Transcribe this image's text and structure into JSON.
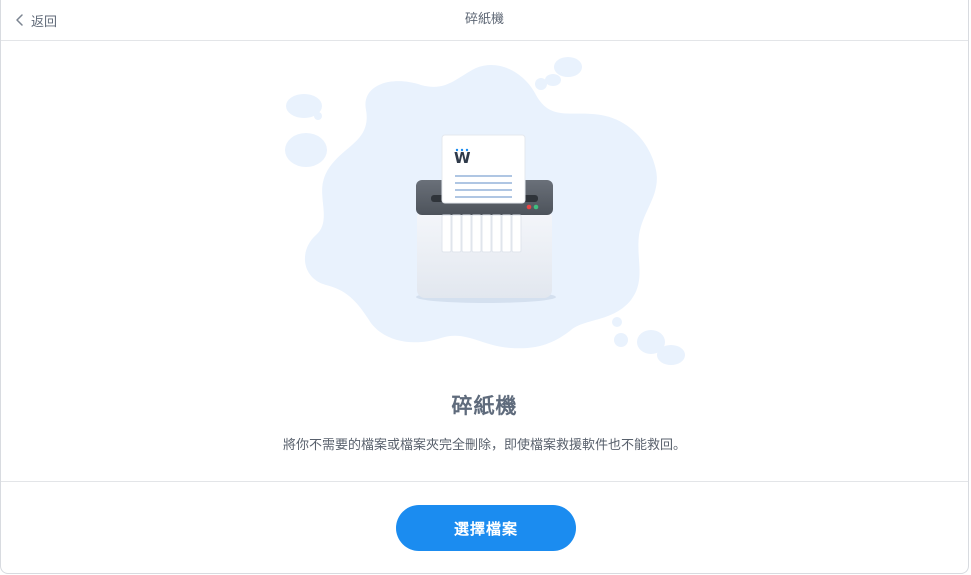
{
  "header": {
    "back_label": "返回",
    "title": "碎紙機"
  },
  "main": {
    "title": "碎紙機",
    "description": "將你不需要的檔案或檔案夾完全刪除，即使檔案救援軟件也不能救回。"
  },
  "footer": {
    "select_button_label": "選擇檔案"
  },
  "colors": {
    "accent": "#1b8cf0",
    "blob": "#e8f2fe",
    "shredder_body": "#eef1f6",
    "shredder_top": "#5a6069"
  },
  "icons": {
    "back": "chevron-left-icon",
    "logo": "w-logo-icon",
    "illustration": "shredder-illustration"
  }
}
